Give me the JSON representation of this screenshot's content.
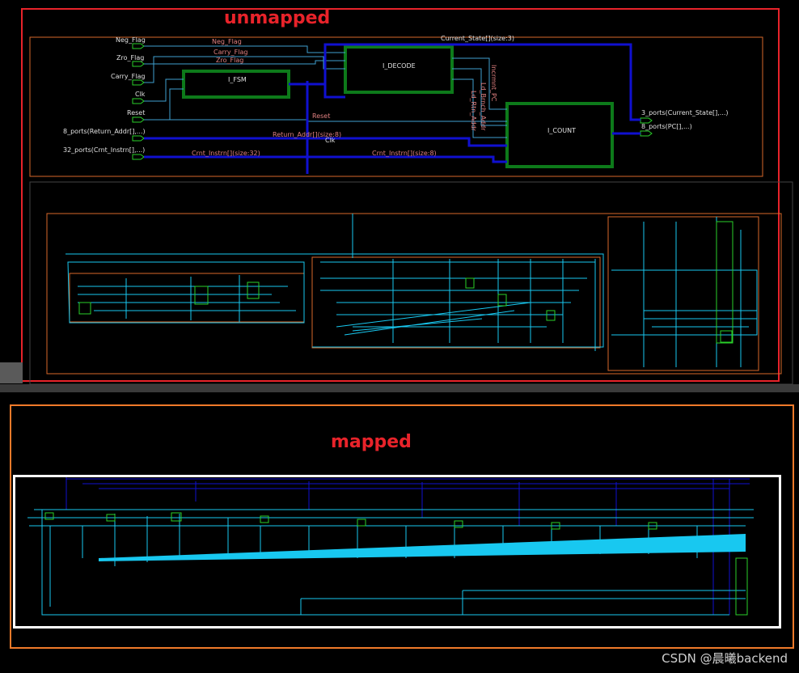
{
  "labels": {
    "unmapped": "unmapped",
    "mapped": "mapped",
    "watermark": "CSDN @晨曦backend"
  },
  "top_schematic": {
    "inputs": [
      "Neg_Flag",
      "Zro_Flag",
      "Carry_Flag",
      "Clk",
      "Reset",
      "8_ports(Return_Addr[],...)",
      "32_ports(Crnt_Instrn[],...)"
    ],
    "blocks": {
      "fsm": "I_FSM",
      "decode": "I_DECODE",
      "count": "I_COUNT"
    },
    "nets": {
      "neg_flag": "Neg_Flag",
      "carry_flag": "Carry_Flag",
      "zro_flag": "Zro_Flag",
      "current_state": "Current_State[](size:3)",
      "reset": "Reset",
      "return_addr": "Return_Addr[](size:8)",
      "clk": "Clk",
      "crnt_instrn_32": "Crnt_Instrn[](size:32)",
      "crnt_instrn_8": "Crnt_Instrn[](size:8)",
      "incrmnt_pc": "Incrmnt_PC",
      "ld_brnch_addr": "Ld_Brnch_Addr",
      "ld_rtn_addr": "Ld_Rtn_Addr"
    },
    "outputs": [
      "3_ports(Current_State[],...)",
      "8_ports(PC[],...)"
    ]
  },
  "colors": {
    "frame_unmapped": "#e8232a",
    "frame_mapped": "#f07a2a",
    "wire_blue": "#1010d0",
    "wire_cyan": "#18c8f0",
    "block_green": "#0d7a1a",
    "instance_border": "#d8682a"
  }
}
